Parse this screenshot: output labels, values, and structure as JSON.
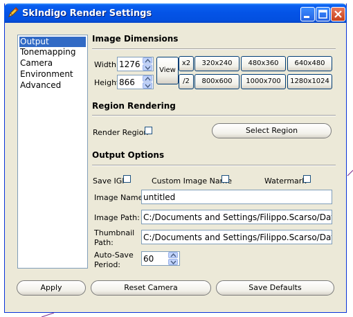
{
  "window": {
    "title": "SkIndigo Render Settings"
  },
  "sidebar": {
    "items": [
      {
        "label": "Output",
        "selected": true
      },
      {
        "label": "Tonemapping",
        "selected": false
      },
      {
        "label": "Camera",
        "selected": false
      },
      {
        "label": "Environment",
        "selected": false
      },
      {
        "label": "Advanced",
        "selected": false
      }
    ]
  },
  "dimensions": {
    "section_title": "Image Dimensions",
    "width_label": "Width:",
    "width_value": "1276",
    "height_label": "Height:",
    "height_value": "866",
    "view_label": "View",
    "x2_label": "x2",
    "half_label": "/2",
    "presets": [
      "320x240",
      "480x360",
      "640x480",
      "800x600",
      "1000x700",
      "1280x1024"
    ]
  },
  "region": {
    "section_title": "Region Rendering",
    "render_region_label": "Render Region",
    "render_region_checked": false,
    "select_region_label": "Select Region"
  },
  "output": {
    "section_title": "Output Options",
    "save_igi_label": "Save IGI",
    "save_igi_checked": false,
    "custom_name_label": "Custom Image Name",
    "custom_name_checked": false,
    "watermark_label": "Watermark",
    "watermark_checked": false,
    "image_name_label": "Image Name:",
    "image_name_value": "untitled",
    "image_path_label": "Image Path:",
    "image_path_value": "C:/Documents and Settings/Filippo.Scarso/Dat",
    "thumbnail_label_1": "Thumbnail",
    "thumbnail_label_2": "Path:",
    "thumbnail_value": "C:/Documents and Settings/Filippo.Scarso/Dat",
    "autosave_label_1": "Auto-Save",
    "autosave_label_2": "Period:",
    "autosave_value": "60"
  },
  "footer": {
    "apply": "Apply",
    "reset_camera": "Reset Camera",
    "save_defaults": "Save Defaults"
  },
  "colors": {
    "titlebar": "#0453e6",
    "selection": "#316ac5",
    "dialog": "#ece9d8"
  }
}
